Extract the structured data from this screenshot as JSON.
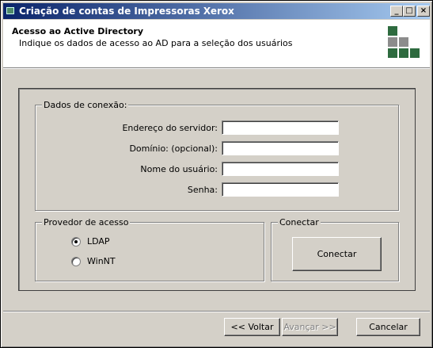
{
  "window": {
    "title": "Criação de contas de Impressoras Xerox",
    "minimize_glyph": "_",
    "maximize_glyph": "□",
    "close_glyph": "×"
  },
  "header": {
    "title": "Acesso ao Active Directory",
    "subtitle": "Indique os dados de acesso ao AD para a seleção dos usuários"
  },
  "connection": {
    "legend": "Dados de conexão:",
    "fields": [
      {
        "label": "Endereço do servidor:",
        "value": ""
      },
      {
        "label": "Domínio: (opcional):",
        "value": ""
      },
      {
        "label": "Nome do usuário:",
        "value": ""
      },
      {
        "label": "Senha:",
        "value": ""
      }
    ]
  },
  "provider": {
    "legend": "Provedor de acesso",
    "options": [
      {
        "label": "LDAP",
        "selected": true
      },
      {
        "label": "WinNT",
        "selected": false
      }
    ]
  },
  "connect": {
    "legend": "Conectar",
    "button_label": "Conectar"
  },
  "footer": {
    "back_label": "<< Voltar",
    "next_label": "Avançar >>",
    "cancel_label": "Cancelar"
  },
  "colors": {
    "titlebar_start": "#0a246a",
    "titlebar_end": "#a6caf0",
    "logo_dark": "#2e6b3f",
    "logo_gray": "#8c8c8c"
  }
}
